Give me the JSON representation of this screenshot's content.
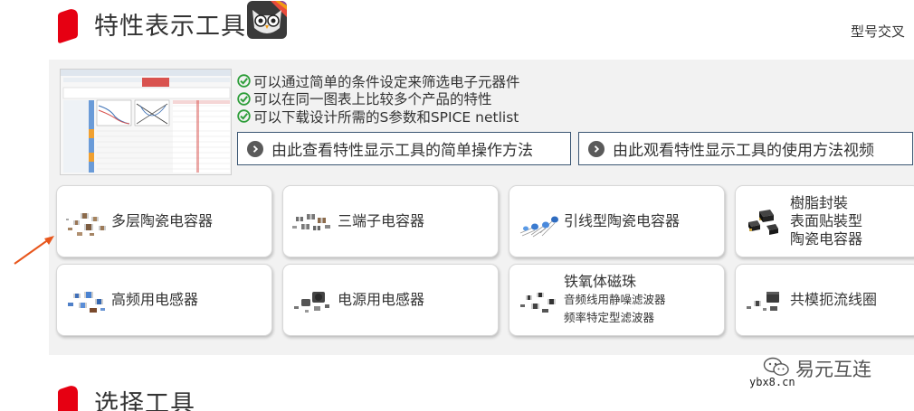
{
  "header": {
    "section_title": "特性表示工具",
    "logo_icon": "owl-logo-icon",
    "top_link": "型号交叉"
  },
  "intro": {
    "thumbnail_icon": "tool-screenshot-thumbnail",
    "features": [
      "可以通过简单的条件设定来筛选电子元器件",
      "可以在同一图表上比较多个产品的特性",
      "可以下载设计所需的S参数和SPICE netlist"
    ],
    "guide_buttons": [
      "由此查看特性显示工具的简单操作方法",
      "由此观看特性显示工具的使用方法视频"
    ]
  },
  "categories": [
    {
      "label": "多层陶瓷电容器",
      "icon": "mlcc-icon"
    },
    {
      "label": "三端子电容器",
      "icon": "three-terminal-capacitor-icon"
    },
    {
      "label": "引线型陶瓷电容器",
      "icon": "leaded-ceramic-capacitor-icon"
    },
    {
      "lines": [
        "樹脂封裝",
        "表面贴裝型",
        "陶瓷电容器"
      ],
      "icon": "resin-molded-capacitor-icon"
    },
    {
      "label": "高频用电感器",
      "icon": "rf-inductor-icon"
    },
    {
      "label": "电源用电感器",
      "icon": "power-inductor-icon"
    },
    {
      "title": "铁氧体磁珠",
      "subs": [
        "音频线用静噪滤波器",
        "频率特定型滤波器"
      ],
      "icon": "ferrite-bead-icon"
    },
    {
      "label": "共模扼流线圈",
      "icon": "common-mode-choke-icon"
    }
  ],
  "next_section": {
    "title": "选择工具"
  },
  "watermark": {
    "name": "易元互连",
    "url": "ybx8.cn"
  },
  "colors": {
    "accent_red": "#e60012",
    "button_border": "#3b5673",
    "arrow": "#e8561c",
    "check_green": "#2e9e3a"
  }
}
